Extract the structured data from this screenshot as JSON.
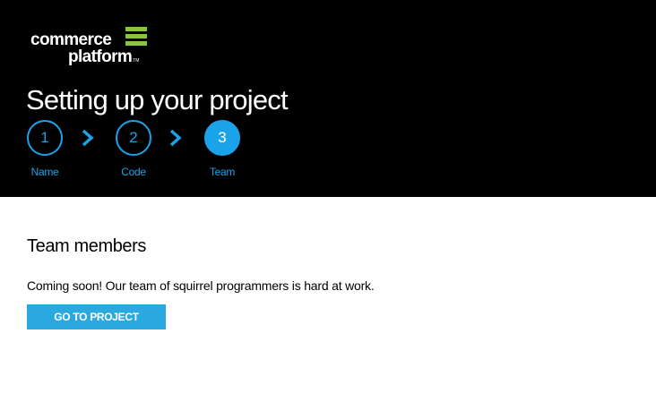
{
  "brand": {
    "line1": "commerce",
    "line2": "platform",
    "tm": "TM",
    "accent_color": "#8ac53f",
    "icon": "stacked-bars-logo-icon"
  },
  "header": {
    "title": "Setting up your project"
  },
  "steps": [
    {
      "number": "1",
      "label": "Name",
      "state": "outlined"
    },
    {
      "number": "2",
      "label": "Code",
      "state": "outlined"
    },
    {
      "number": "3",
      "label": "Team",
      "state": "active"
    }
  ],
  "step_separator_icon": "chevron-right-icon",
  "step_color": "#1aa3e8",
  "main": {
    "section_title": "Team members",
    "message": "Coming soon! Our team of squirrel programmers is hard at work.",
    "button_label": "GO TO PROJECT",
    "button_color": "#2aa9e0"
  }
}
